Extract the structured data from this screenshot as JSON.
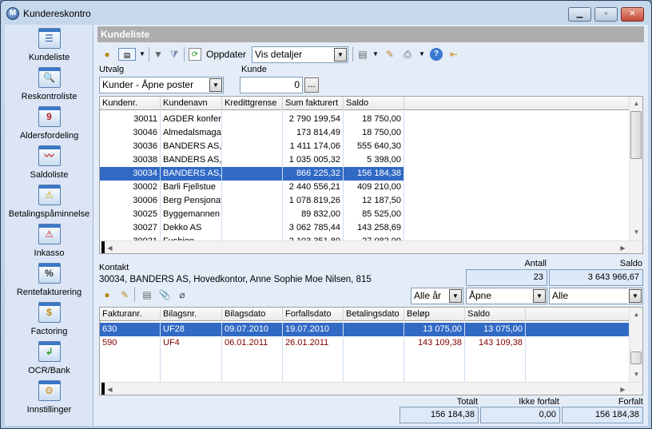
{
  "window": {
    "title": "Kundereskontro",
    "app_icon": "M",
    "controls": {
      "minimize": "minimize-icon",
      "maximize": "maximize-icon",
      "close": "close-icon"
    }
  },
  "sidebar": {
    "items": [
      {
        "label": "Kundeliste",
        "icon": "customer-list-icon",
        "glyph": "☰"
      },
      {
        "label": "Reskontroliste",
        "icon": "magnifier-list-icon",
        "glyph": "🔍"
      },
      {
        "label": "Aldersfordeling",
        "icon": "calendar-icon",
        "glyph": "9"
      },
      {
        "label": "Saldoliste",
        "icon": "chart-list-icon",
        "glyph": "〰"
      },
      {
        "label": "Betalingspåminnelse",
        "icon": "warning-yellow-icon",
        "glyph": "⚠"
      },
      {
        "label": "Inkasso",
        "icon": "warning-red-icon",
        "glyph": "⚠"
      },
      {
        "label": "Rentefakturering",
        "icon": "percent-icon",
        "glyph": "%"
      },
      {
        "label": "Factoring",
        "icon": "coins-icon",
        "glyph": "$"
      },
      {
        "label": "OCR/Bank",
        "icon": "document-import-icon",
        "glyph": "↲"
      },
      {
        "label": "Innstillinger",
        "icon": "settings-gear-icon",
        "glyph": "⚙"
      }
    ]
  },
  "panel": {
    "title": "Kundeliste",
    "toolbar": {
      "refresh_label": "Oppdater",
      "view_select": "Vis detaljer"
    },
    "filter": {
      "utvalg_label": "Utvalg",
      "utvalg_value": "Kunder - Åpne poster",
      "kunde_label": "Kunde",
      "kunde_value": "0",
      "browse_label": "..."
    },
    "customers": {
      "columns": [
        "Kundenr.",
        "Kundenavn",
        "Kredittgrense",
        "Sum fakturert",
        "Saldo"
      ],
      "rows": [
        {
          "nr": "30011",
          "name": "AGDER konferanse",
          "limit": "",
          "sum": "2 790 199,54",
          "saldo": "18 750,00"
        },
        {
          "nr": "30046",
          "name": "Almedalsmagasin",
          "limit": "",
          "sum": "173 814,49",
          "saldo": "18 750,00"
        },
        {
          "nr": "30036",
          "name": "BANDERS AS,",
          "limit": "",
          "sum": "1 411 174,06",
          "saldo": "555 640,30"
        },
        {
          "nr": "30038",
          "name": "BANDERS AS,",
          "limit": "",
          "sum": "1 035 005,32",
          "saldo": "5 398,00"
        },
        {
          "nr": "30034",
          "name": "BANDERS AS,",
          "limit": "",
          "sum": "866 225,32",
          "saldo": "156 184,38",
          "selected": true
        },
        {
          "nr": "30002",
          "name": "Barli Fjellstue",
          "limit": "",
          "sum": "2 440 556,21",
          "saldo": "409 210,00"
        },
        {
          "nr": "30006",
          "name": "Berg Pensjonat",
          "limit": "",
          "sum": "1 078 819,26",
          "saldo": "12 187,50"
        },
        {
          "nr": "30025",
          "name": "Byggemannen AS",
          "limit": "",
          "sum": "89 832,00",
          "saldo": "85 525,00"
        },
        {
          "nr": "30027",
          "name": "Dekko AS",
          "limit": "",
          "sum": "3 062 785,44",
          "saldo": "143 258,69"
        },
        {
          "nr": "30021",
          "name": "Fushion",
          "limit": "",
          "sum": "2 103 351,80",
          "saldo": "27 082,00"
        }
      ]
    },
    "contact": {
      "label": "Kontakt",
      "value": "30034, BANDERS AS, Hovedkontor, Anne Sophie Moe Nilsen, 815",
      "antall_label": "Antall",
      "antall_value": "23",
      "saldo_label": "Saldo",
      "saldo_value": "3 643 966,67"
    },
    "invoice_filters": {
      "year": "Alle år",
      "status": "Åpne",
      "type": "Alle"
    },
    "invoices": {
      "columns": [
        "Fakturanr.",
        "Bilagsnr.",
        "Bilagsdato",
        "Forfallsdato",
        "Betalingsdato",
        "Beløp",
        "Saldo"
      ],
      "rows": [
        {
          "faktura": "630",
          "bilag": "UF28",
          "bilagsdato": "09.07.2010",
          "forfall": "19.07.2010",
          "betaling": "",
          "belop": "13 075,00",
          "saldo": "13 075,00",
          "selected": true
        },
        {
          "faktura": "590",
          "bilag": "UF4",
          "bilagsdato": "06.01.2011",
          "forfall": "26.01.2011",
          "betaling": "",
          "belop": "143 109,38",
          "saldo": "143 109,38",
          "overdue": true
        }
      ]
    },
    "totals": {
      "totalt_label": "Totalt",
      "totalt_value": "156 184,38",
      "ikke_forfalt_label": "Ikke forfalt",
      "ikke_forfalt_value": "0,00",
      "forfalt_label": "Forfalt",
      "forfalt_value": "156 184,38"
    }
  },
  "colors": {
    "selection": "#316ac5",
    "overdue_text": "#800000",
    "panel_header": "#adadad"
  }
}
